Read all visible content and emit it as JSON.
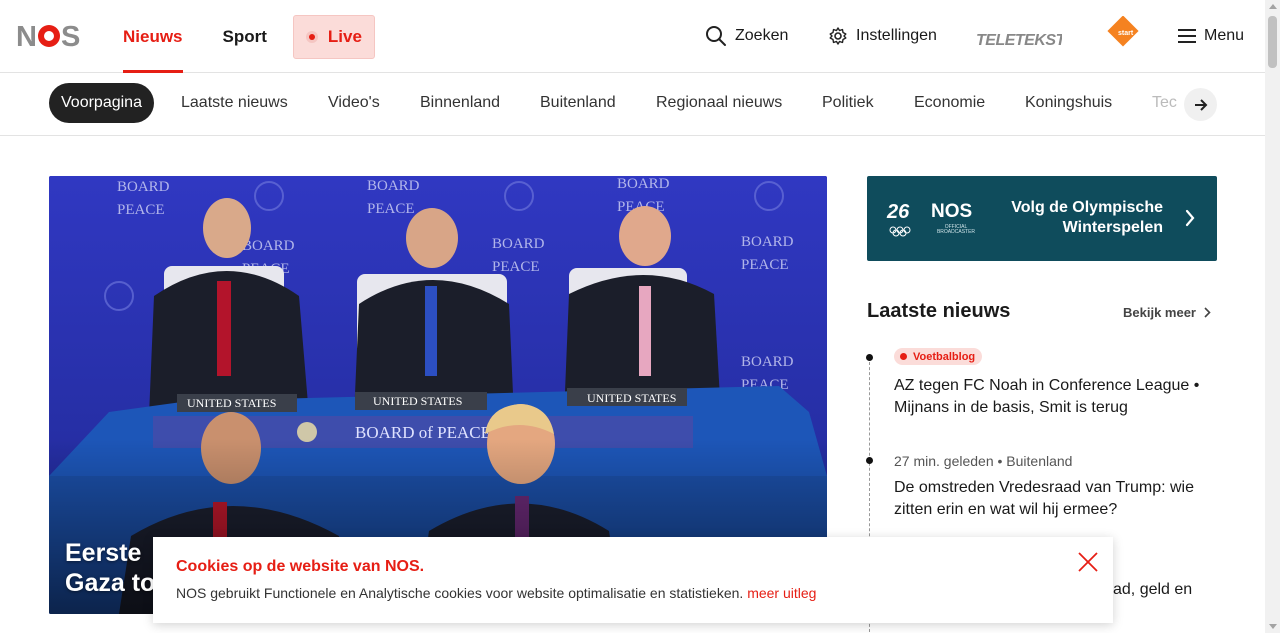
{
  "header": {
    "logo_text": "NOS",
    "nav": [
      {
        "label": "Nieuws",
        "active": true
      },
      {
        "label": "Sport",
        "active": false
      }
    ],
    "live_label": "Live",
    "search_label": "Zoeken",
    "settings_label": "Instellingen",
    "teletekst_label": "TELETEKST",
    "npo_start_label": "start",
    "menu_label": "Menu"
  },
  "categories": [
    {
      "label": "Voorpagina",
      "active": true
    },
    {
      "label": "Laatste nieuws"
    },
    {
      "label": "Video's"
    },
    {
      "label": "Binnenland"
    },
    {
      "label": "Buitenland"
    },
    {
      "label": "Regionaal nieuws"
    },
    {
      "label": "Politiek"
    },
    {
      "label": "Economie"
    },
    {
      "label": "Koningshuis"
    },
    {
      "label": "Tec"
    }
  ],
  "hero": {
    "title_line1": "Eerste",
    "title_line2": "Gaza to"
  },
  "olympic": {
    "line1": "Volg de Olympische",
    "line2": "Winterspelen",
    "nos_text": "NOS",
    "sub_text": "OFFICIAL BROADCASTER"
  },
  "latest": {
    "title": "Laatste nieuws",
    "more_label": "Bekijk meer",
    "items": [
      {
        "tag": "Voetbalblog",
        "headline_1": "AZ tegen FC Noah in Conference League •",
        "headline_2": "Mijnans in de basis, Smit is terug"
      },
      {
        "meta": "27 min. geleden • Buitenland",
        "headline_1": "De omstreden Vredesraad van Trump: wie",
        "headline_2": "zitten erin en wat wil hij ermee?"
      },
      {
        "headline_partial": "ad, geld en"
      }
    ]
  },
  "cookie": {
    "title": "Cookies op de website van NOS.",
    "text": "NOS gebruikt Functionele en Analytische cookies voor website optimalisatie en statistieken.",
    "link": "meer uitleg"
  },
  "colors": {
    "brand_red": "#e61e14",
    "olympic_teal": "#0f4c5c",
    "hero_blue": "#2b35b8"
  }
}
